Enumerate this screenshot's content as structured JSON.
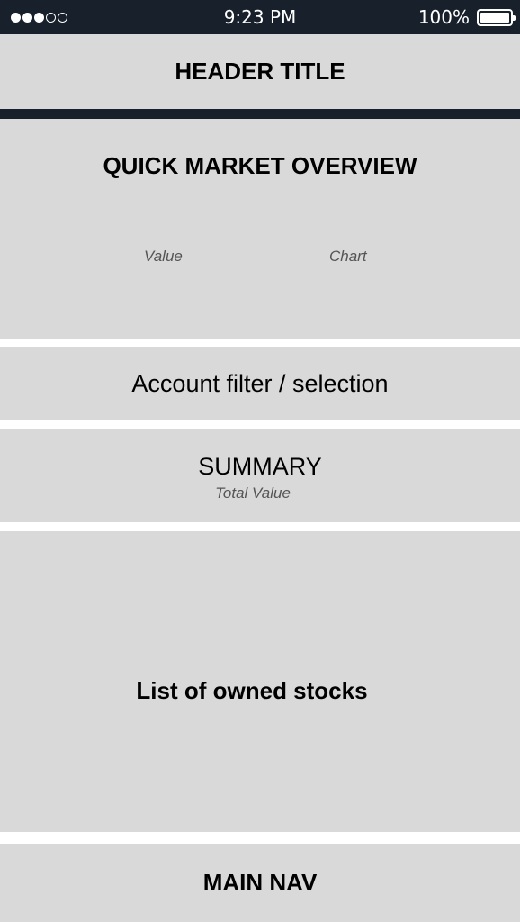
{
  "status_bar": {
    "signal_full": 3,
    "signal_empty": 2,
    "time": "9:23 PM",
    "battery_percent": "100%",
    "battery_level": 1.0
  },
  "header": {
    "title": "HEADER TITLE"
  },
  "market_overview": {
    "title": "QUICK MARKET OVERVIEW",
    "value_label": "Value",
    "chart_label": "Chart"
  },
  "account_filter": {
    "label": "Account filter / selection"
  },
  "summary": {
    "title": "SUMMARY",
    "subtitle": "Total Value"
  },
  "stocks": {
    "label": "List of owned stocks"
  },
  "main_nav": {
    "label": "MAIN NAV"
  },
  "colors": {
    "status_bar": "#18202b",
    "block": "#d9d9d9",
    "divider": "#ffffff"
  }
}
